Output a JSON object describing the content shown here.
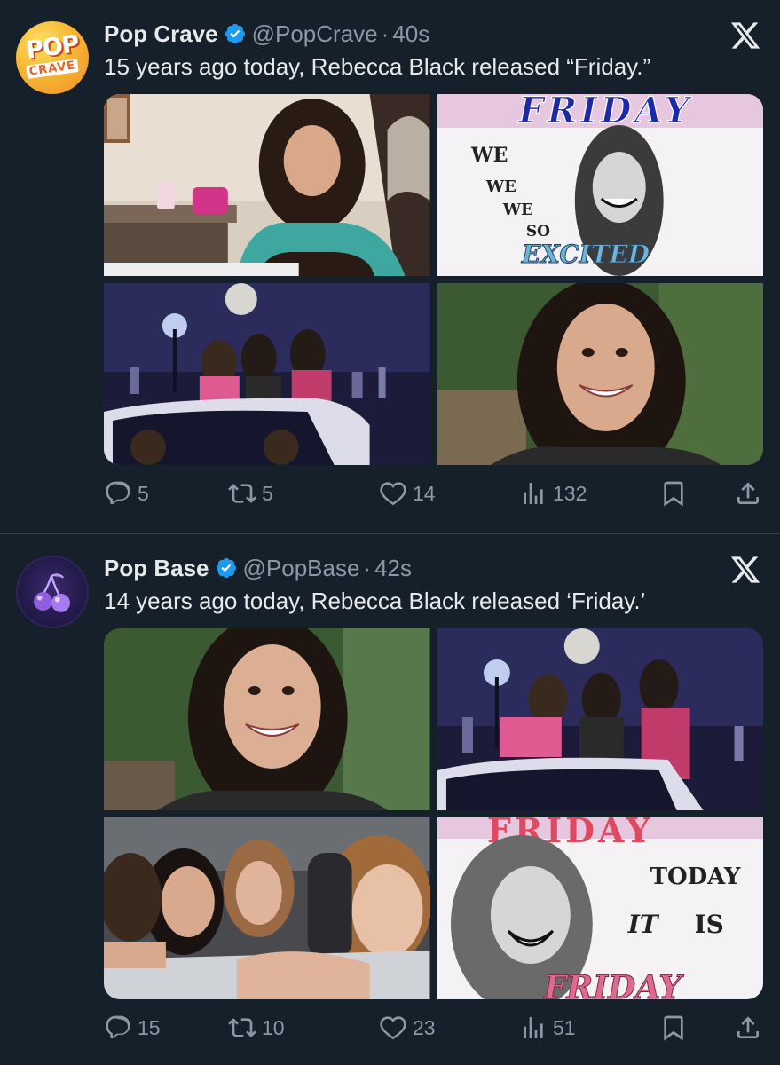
{
  "tweets": [
    {
      "display_name": "Pop Crave",
      "handle": "@PopCrave",
      "separator": "·",
      "time": "40s",
      "text": "15 years ago today, Rebecca Black released “Friday.”",
      "avatar": {
        "top": "POP",
        "bottom": "CRAVE"
      },
      "images": [
        {
          "caption": []
        },
        {
          "caption": [
            "FRIDAY",
            "WE",
            "WE",
            "WE",
            "SO",
            "EXCITED"
          ]
        },
        {
          "caption": []
        },
        {
          "caption": []
        }
      ],
      "stats": {
        "replies": "5",
        "retweets": "5",
        "likes": "14",
        "views": "132"
      }
    },
    {
      "display_name": "Pop Base",
      "handle": "@PopBase",
      "separator": "·",
      "time": "42s",
      "text": "14 years ago today, Rebecca Black released ‘Friday.’",
      "images": [
        {
          "caption": []
        },
        {
          "caption": []
        },
        {
          "caption": []
        },
        {
          "caption": [
            "FRIDAY",
            "TODAY",
            "IT",
            "IS",
            "FRIDAY"
          ]
        }
      ],
      "stats": {
        "replies": "15",
        "retweets": "10",
        "likes": "23",
        "views": "51"
      }
    }
  ],
  "colors": {
    "background": "#15202b",
    "text": "#e7e9ea",
    "muted": "#8b98a5",
    "verified": "#1d9bf0",
    "divider": "#38444d"
  },
  "icons": [
    "x-logo-icon",
    "verified-badge-icon",
    "reply-icon",
    "retweet-icon",
    "like-icon",
    "views-icon",
    "bookmark-icon",
    "share-icon",
    "cherry-icon"
  ]
}
